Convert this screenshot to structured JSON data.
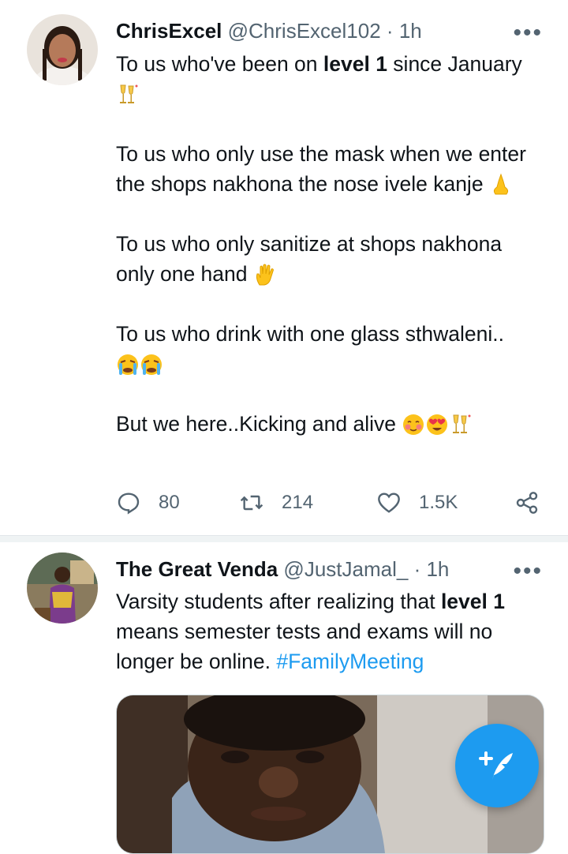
{
  "tweets": [
    {
      "name": "ChrisExcel",
      "handle": "@ChrisExcel102",
      "separator": "·",
      "time": "1h",
      "more": "•••",
      "body": {
        "p1_a": "To us who've been on ",
        "p1_b": "level 1",
        "p1_c": " since January",
        "p2": "To us who only use the mask when we enter the shops nakhona the nose ivele kanje",
        "p3": "To us who only sanitize at shops nakhona only one hand",
        "p4": "To us who drink with one glass sthwaleni..",
        "p5": "But we here..Kicking and alive"
      },
      "actions": {
        "reply_count": "80",
        "retweet_count": "214",
        "like_count": "1.5K"
      }
    },
    {
      "name": "The Great Venda",
      "handle": "@JustJamal_",
      "separator": "·",
      "time": "1h",
      "more": "•••",
      "body": {
        "a": "Varsity students after realizing that ",
        "b": "level 1",
        "c": " means semester tests and exams will no longer be online. ",
        "hashtag": "#FamilyMeeting"
      }
    }
  ],
  "icons": {
    "reply": "reply-icon",
    "retweet": "retweet-icon",
    "like": "heart-icon",
    "share": "share-icon",
    "compose": "compose-tweet-icon"
  },
  "colors": {
    "accent": "#1d9bf0",
    "text": "#0f1419",
    "muted": "#536471"
  }
}
